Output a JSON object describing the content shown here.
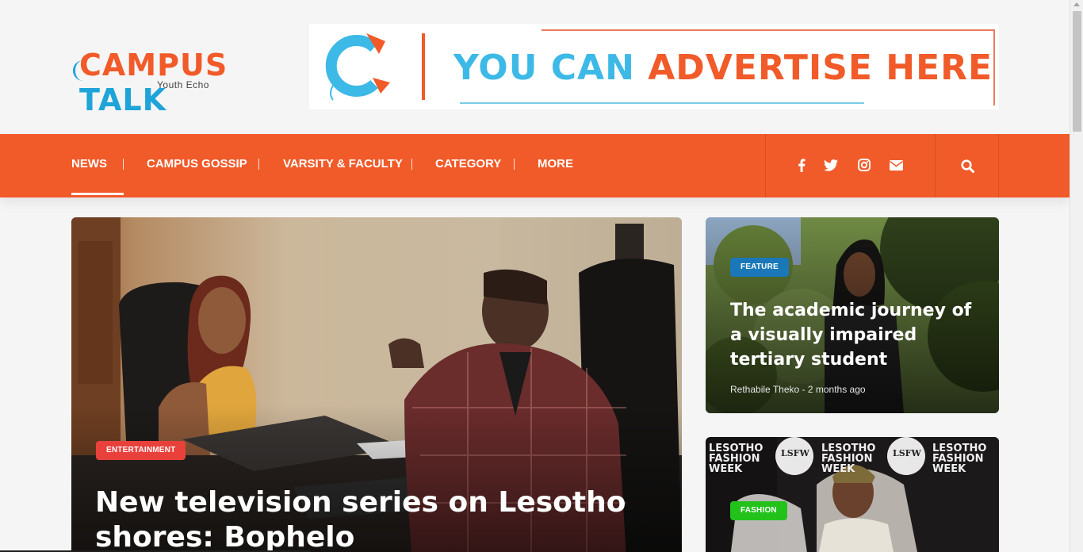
{
  "brand": {
    "name_part1": "C",
    "name_part2": "AMPUS ",
    "name_part3": "TALK",
    "tagline": "Youth Echo"
  },
  "ad": {
    "text_part1": "YOU CAN ",
    "text_part2": "ADVERTISE HERE"
  },
  "nav": {
    "items": [
      {
        "label": "NEWS",
        "active": true
      },
      {
        "label": "CAMPUS GOSSIP",
        "active": false
      },
      {
        "label": "VARSITY & FACULTY",
        "active": false
      },
      {
        "label": "CATEGORY",
        "active": false
      },
      {
        "label": "MORE",
        "active": false
      }
    ],
    "social_icons": [
      "facebook-icon",
      "twitter-icon",
      "instagram-icon",
      "envelope-icon"
    ],
    "search_icon": "search-icon"
  },
  "featured": {
    "category": "ENTERTAINMENT",
    "title": "New television series on Lesotho shores: Bophelo"
  },
  "side_posts": [
    {
      "category": "FEATURE",
      "title": "The academic journey of a visually impaired tertiary student",
      "author": "Rethabile Theko",
      "time": "2 months ago"
    },
    {
      "category": "FASHION",
      "backdrop_text": "LESOTHO FASHION WEEK",
      "backdrop_logo": "LSFW"
    }
  ],
  "colors": {
    "accent": "#f15a29",
    "brand_blue": "#1ea4d8",
    "badge_entertainment": "#e8413c",
    "badge_feature": "#1a78b8",
    "badge_fashion": "#22c21b"
  }
}
